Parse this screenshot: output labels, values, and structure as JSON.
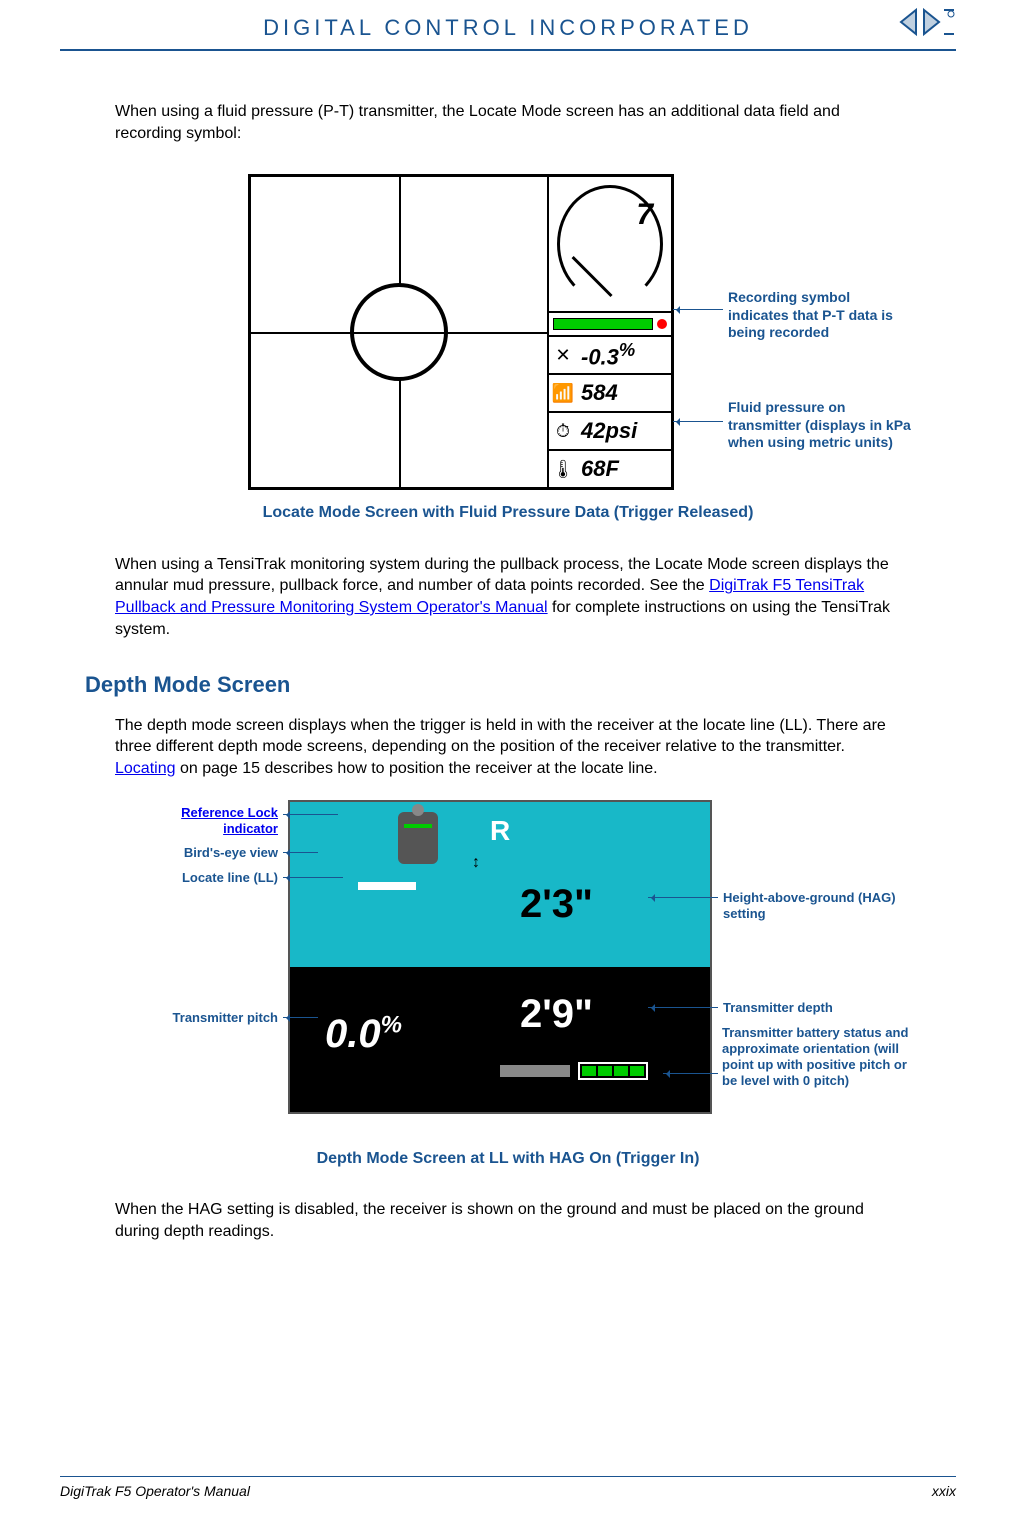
{
  "header": {
    "company": "DIGITAL CONTROL INCORPORATED"
  },
  "intro": "When using a fluid pressure (P-T) transmitter, the Locate Mode screen has an additional data field and recording symbol:",
  "fig1": {
    "gauge": "7",
    "pitch": "-0.3",
    "pitch_unit": "%",
    "signal": "584",
    "pressure": "42psi",
    "temp": "68F",
    "annot1": "Recording symbol indicates that P-T data is being recorded",
    "annot2": "Fluid pressure on transmitter (displays in kPa when using metric units)",
    "caption": "Locate Mode Screen with Fluid Pressure Data (Trigger Released)"
  },
  "para2a": "When using a TensiTrak monitoring system during the pullback process, the Locate Mode screen displays the annular mud pressure, pullback force, and number of data points recorded. See the ",
  "para2link": "DigiTrak F5 TensiTrak Pullback and Pressure Monitoring System Operator's Manual",
  "para2b": " for complete instructions on using the TensiTrak system.",
  "h2": "Depth Mode Screen",
  "para3a": "The depth mode screen displays when the trigger is held in with the receiver at the locate line (LL). There are three different depth mode screens, depending on the position of the receiver relative to the transmitter. ",
  "para3link": "Locating",
  "para3b": " on page 15 describes how to position the receiver at the locate line.",
  "fig2": {
    "r": "R",
    "hag": "2'3\"",
    "pitch": "0.0",
    "pct": "%",
    "depth": "2'9\"",
    "left1": "Reference Lock indicator",
    "left2": "Bird's-eye view",
    "left3": "Locate line (LL)",
    "left4": "Transmitter pitch",
    "right1": "Height-above-ground (HAG) setting",
    "right2": "Transmitter depth",
    "right3": "Transmitter battery status and approximate orientation (will point up with positive pitch or be level with 0 pitch)",
    "caption": "Depth Mode Screen at LL with HAG On (Trigger In)"
  },
  "para4": "When the HAG setting is disabled, the receiver is shown on the ground and must be placed on the ground during depth readings.",
  "footer": {
    "left": "DigiTrak F5 Operator's Manual",
    "right": "xxix"
  }
}
